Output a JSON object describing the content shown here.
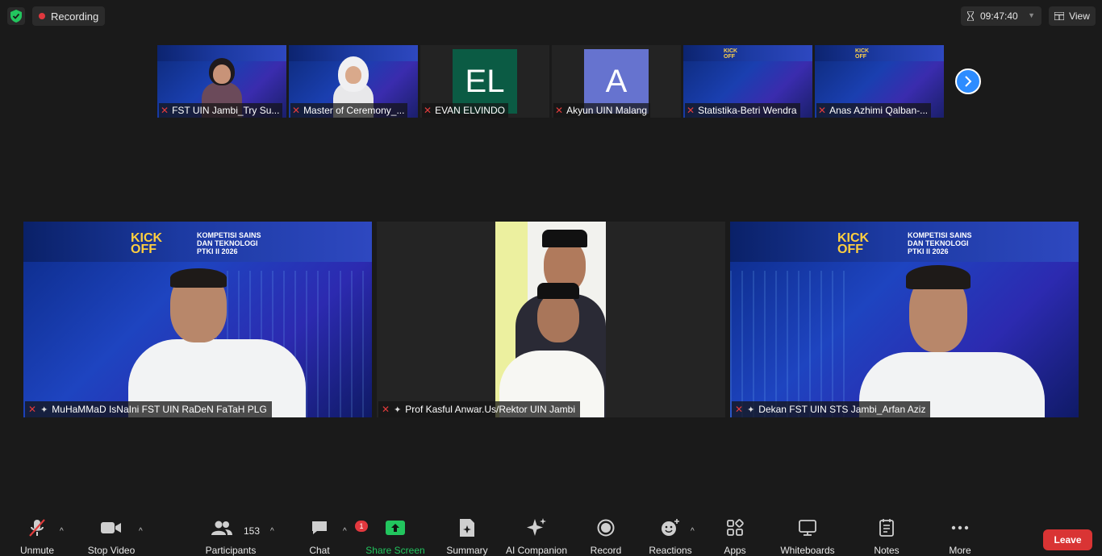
{
  "top": {
    "recording_label": "Recording",
    "timer": "09:47:40",
    "view_label": "View"
  },
  "thumbnails": [
    {
      "name": "FST UIN Jambi_Try Su...",
      "type": "video",
      "bg": "#1b3aa8"
    },
    {
      "name": "Master of Ceremony_...",
      "type": "video",
      "bg": "#1b3aa8"
    },
    {
      "name": "EVAN ELVINDO",
      "type": "avatar",
      "initials": "EL",
      "color": "#0b5b44"
    },
    {
      "name": "Akyun UIN Malang",
      "type": "avatar",
      "initials": "A",
      "color": "#6673cf"
    },
    {
      "name": "Statistika-Betri Wendra",
      "type": "banner"
    },
    {
      "name": "Anas Azhimi Qalban-...",
      "type": "banner"
    }
  ],
  "banner_text": {
    "kick": "KICK",
    "off": "OFF",
    "comp1": "KOMPETISI SAINS",
    "comp2": "DAN TEKNOLOGI",
    "comp3": "PTKI II 2026"
  },
  "main_tiles": [
    {
      "name": "MuHaMMaD IsNaIni FST UIN RaDeN FaTaH PLG"
    },
    {
      "name": "Prof Kasful Anwar.Us/Rektor UIN Jambi"
    },
    {
      "name": "Dekan FST UIN STS Jambi_Arfan Aziz"
    }
  ],
  "toolbar": {
    "unmute": "Unmute",
    "stop_video": "Stop Video",
    "participants": "Participants",
    "participants_count": "153",
    "chat": "Chat",
    "chat_badge": "1",
    "share_screen": "Share Screen",
    "summary": "Summary",
    "ai_companion": "AI Companion",
    "record": "Record",
    "reactions": "Reactions",
    "apps": "Apps",
    "whiteboards": "Whiteboards",
    "notes": "Notes",
    "more": "More",
    "leave": "Leave"
  },
  "colors": {
    "share_green": "#22c55e",
    "leave_red": "#d93434",
    "next_blue": "#2d8cff",
    "recording_red": "#e0383e"
  }
}
